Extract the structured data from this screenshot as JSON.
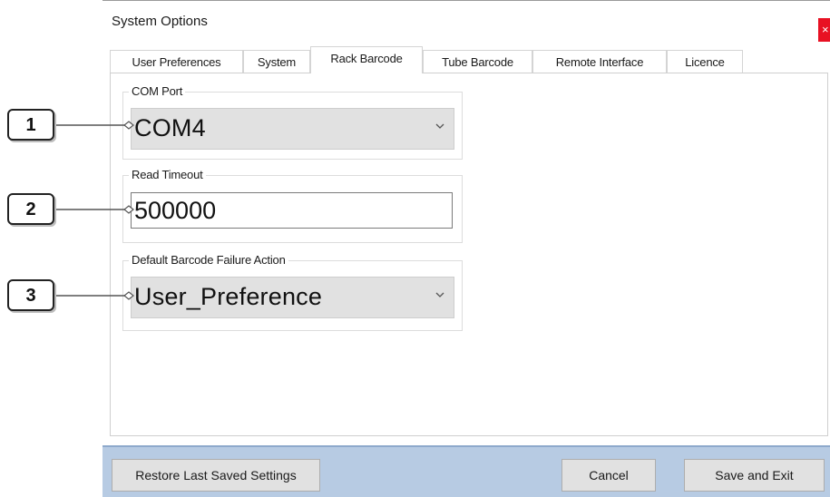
{
  "window": {
    "title": "System Options",
    "close_glyph": "×"
  },
  "tabs": [
    {
      "label": "User Preferences"
    },
    {
      "label": "System"
    },
    {
      "label": "Rack Barcode"
    },
    {
      "label": "Tube Barcode"
    },
    {
      "label": "Remote Interface"
    },
    {
      "label": "Licence"
    }
  ],
  "active_tab": "Rack Barcode",
  "com_port": {
    "label": "COM Port",
    "value": "COM4"
  },
  "read_timeout": {
    "label": "Read Timeout",
    "value": "500000"
  },
  "failure_action": {
    "label": "Default Barcode Failure Action",
    "value": "User_Preference"
  },
  "callouts": [
    {
      "number": "1"
    },
    {
      "number": "2"
    },
    {
      "number": "3"
    }
  ],
  "footer": {
    "restore_label": "Restore Last Saved Settings",
    "cancel_label": "Cancel",
    "save_label": "Save and Exit"
  },
  "colors": {
    "accent_close": "#e81123",
    "footer_bg": "#b7cbe3"
  }
}
